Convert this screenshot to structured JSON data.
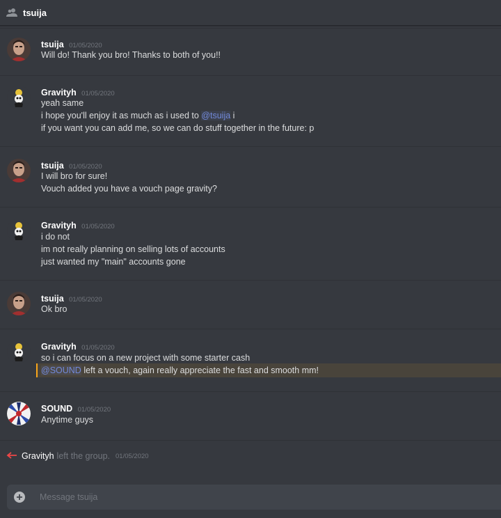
{
  "header": {
    "title": "tsuija",
    "icon": "users-icon"
  },
  "colors": {
    "background": "#36393f",
    "mention": "#7289da",
    "highlight_bar": "#faa61a",
    "leave_arrow": "#f04747"
  },
  "messages": [
    {
      "author": "tsuija",
      "timestamp": "01/05/2020",
      "lines": [
        "Will do! Thank you bro! Thanks to both of you!!"
      ]
    },
    {
      "author": "Gravityh",
      "timestamp": "01/05/2020",
      "lines": [
        "yeah same",
        "i hope you'll enjoy it as much as i used to",
        "if you want you can add me, so we can do stuff together in the future: p"
      ],
      "mention": "@tsuija",
      "mention_suffix": " i"
    },
    {
      "author": "tsuija",
      "timestamp": "01/05/2020",
      "lines": [
        "I will bro for sure!",
        "Vouch added you have a vouch page gravity?"
      ]
    },
    {
      "author": "Gravityh",
      "timestamp": "01/05/2020",
      "lines": [
        "i do not",
        "im not really planning on  selling lots of accounts",
        "just wanted my \"main\" accounts gone"
      ]
    },
    {
      "author": "tsuija",
      "timestamp": "01/05/2020",
      "lines": [
        "Ok bro"
      ]
    },
    {
      "author": "Gravityh",
      "timestamp": "01/05/2020",
      "lines": [
        "so i can focus on a new project with some starter cash"
      ],
      "mention": "@SOUND",
      "mention_suffix": " left a vouch, again really appreciate the fast and smooth mm!"
    },
    {
      "author": "SOUND",
      "timestamp": "01/05/2020",
      "lines": [
        "Anytime guys"
      ]
    }
  ],
  "system": {
    "user": "Gravityh",
    "text": "left the group.",
    "timestamp": "01/05/2020"
  },
  "composer": {
    "placeholder": "Message tsuija"
  }
}
